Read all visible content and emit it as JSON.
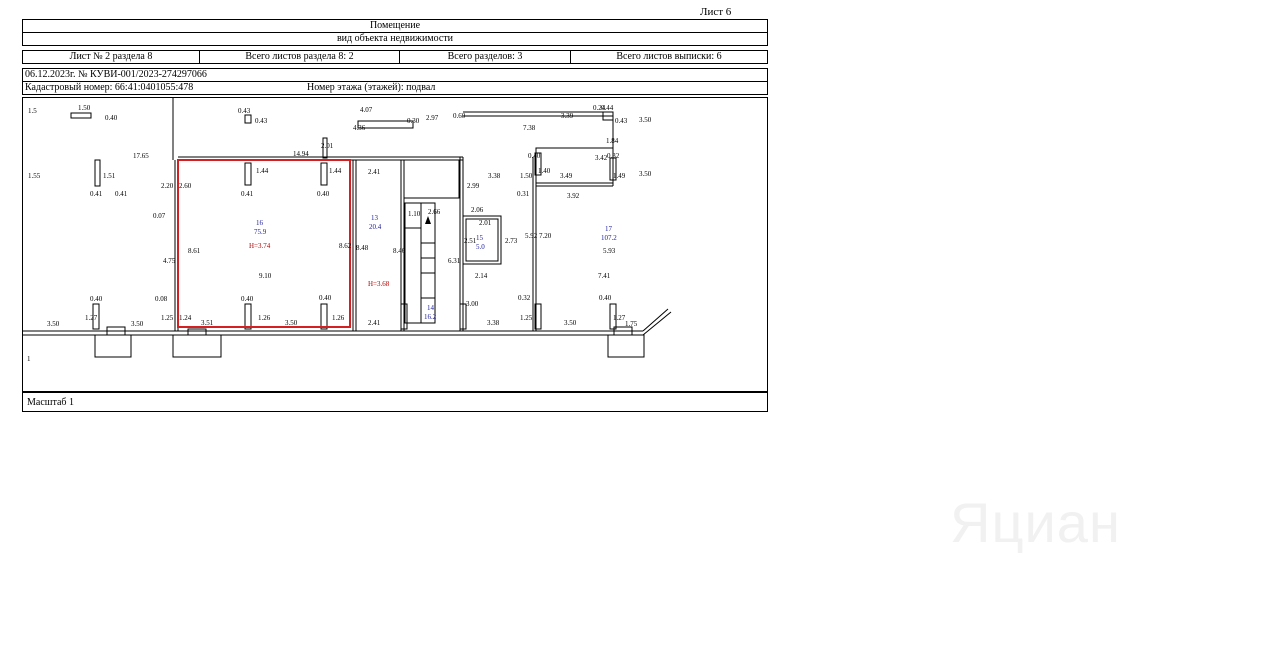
{
  "header": {
    "sheet_number": "Лист 6",
    "title": "Помещение",
    "subtitle": "вид объекта недвижимости",
    "cells": [
      "Лист № 2 раздела 8",
      "Всего листов раздела 8: 2",
      "Всего разделов: 3",
      "Всего листов выписки: 6"
    ],
    "record": "06.12.2023г. № КУВИ-001/2023-274297066",
    "cadastral": "Кадастровый номер: 66:41:0401055:478",
    "floor": "Номер этажа (этажей): подвал"
  },
  "plan": {
    "rooms": [
      {
        "num": "16",
        "area": "75.9",
        "height": "H=3.74"
      },
      {
        "num": "13",
        "area": "20.4"
      },
      {
        "num": "15",
        "area": "5.0"
      },
      {
        "num": "14",
        "area": "16.2"
      },
      {
        "num": "17",
        "area": "107.2"
      }
    ],
    "height_h368": "H=3.68",
    "marker": "1",
    "dims": [
      "1.5",
      "1.50",
      "0.40",
      "0.43",
      "0.43",
      "4.07",
      "4.36",
      "0.30",
      "2.97",
      "0.60",
      "0.24",
      "0.44",
      "7.38",
      "3.39",
      "0.43",
      "3.50",
      "1.55",
      "1.51",
      "0.41",
      "17.65",
      "2.01",
      "14.94",
      "1.84",
      "0.40",
      "3.42",
      "0.32",
      "2.20",
      "2.60",
      "1.44",
      "1.44",
      "2.41",
      "2.99",
      "3.38",
      "1.50",
      "1.40",
      "3.49",
      "1.49",
      "3.50",
      "0.41",
      "0.40",
      "0.41",
      "0.31",
      "3.92",
      "0.07",
      "1.10",
      "2.66",
      "2.06",
      "2.01",
      "8.61",
      "8.62",
      "8.48",
      "8.46",
      "2.51",
      "2.73",
      "5.92",
      "7.20",
      "5.93",
      "4.75",
      "6.31",
      "2.14",
      "9.10",
      "7.41",
      "0.40",
      "0.08",
      "0.40",
      "0.40",
      "3.00",
      "0.32",
      "0.40",
      "1.27",
      "1.25",
      "1.24",
      "1.26",
      "1.26",
      "1.25",
      "1.27",
      "3.50",
      "3.50",
      "3.51",
      "3.50",
      "2.41",
      "3.38",
      "3.50",
      "1.75"
    ]
  },
  "footer": {
    "scale": "Масштаб 1"
  },
  "watermark": "Яциан"
}
